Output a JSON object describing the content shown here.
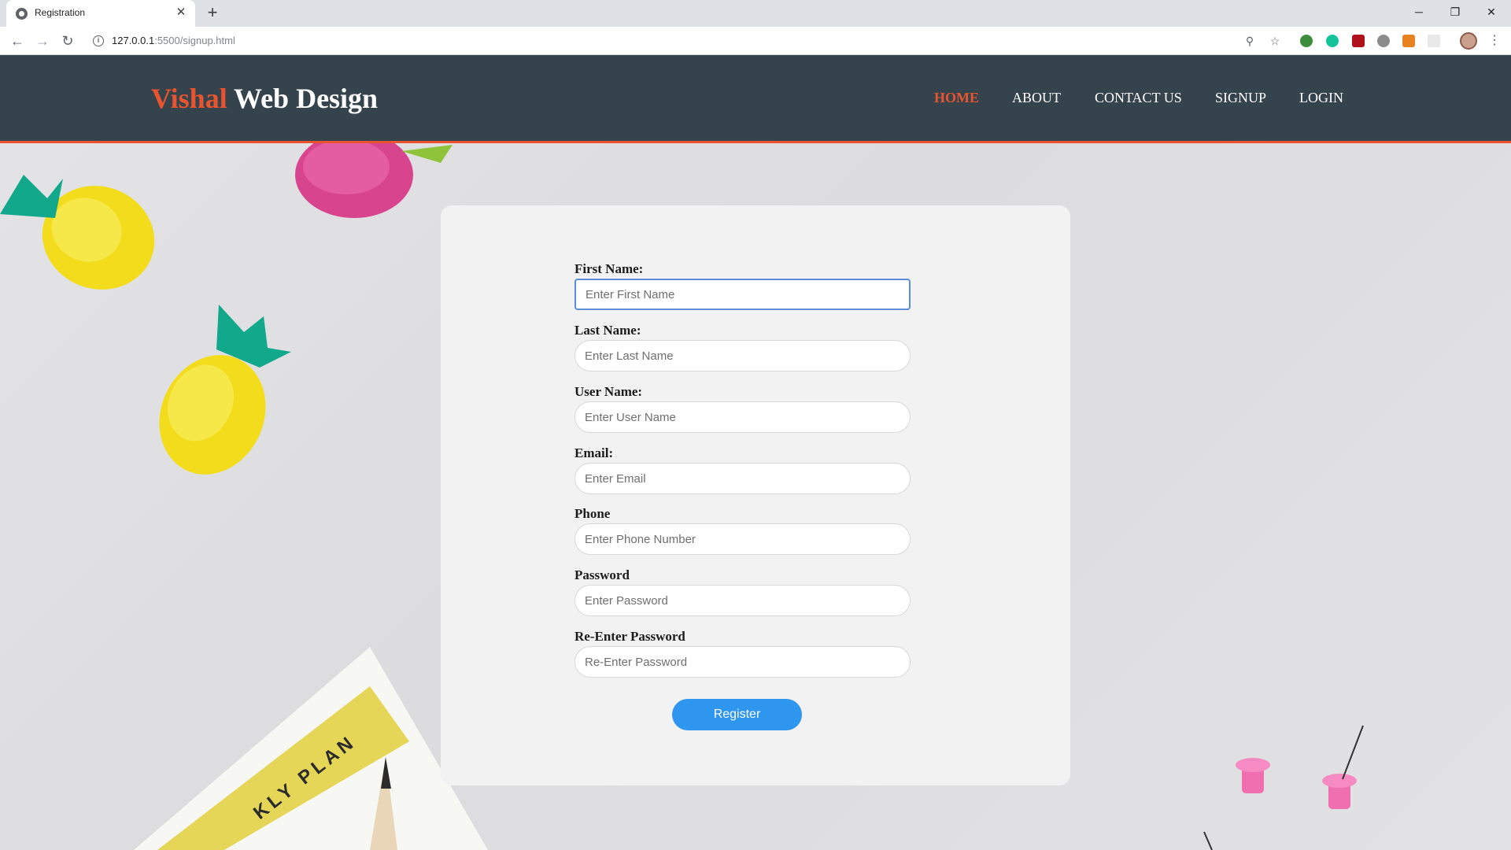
{
  "browser": {
    "tab_title": "Registration",
    "url_host": "127.0.0.1",
    "url_rest": ":5500/signup.html",
    "tab_close": "✕",
    "new_tab": "+",
    "window_controls": {
      "minimize": "─",
      "restore": "❐",
      "close": "✕"
    },
    "icons": [
      "back-icon",
      "forward-icon",
      "reload-icon",
      "info-icon",
      "zoom-icon",
      "star-icon",
      "extension-icons",
      "profile-avatar",
      "menu-icon"
    ]
  },
  "site": {
    "logo_accent": "Vishal",
    "logo_rest": " Web Design",
    "nav": [
      {
        "label": "HOME",
        "active": true
      },
      {
        "label": "ABOUT",
        "active": false
      },
      {
        "label": "CONTACT US",
        "active": false
      },
      {
        "label": "SIGNUP",
        "active": false
      },
      {
        "label": "LOGIN",
        "active": false
      }
    ],
    "colors": {
      "header_bg": "#35434d",
      "accent": "#e8542f",
      "button": "#2f96f0",
      "card_bg": "#f2f2f2"
    }
  },
  "form": {
    "fields": [
      {
        "label": "First Name:",
        "placeholder": "Enter First Name",
        "value": "",
        "focused": true
      },
      {
        "label": "Last Name:",
        "placeholder": "Enter Last Name",
        "value": ""
      },
      {
        "label": "User Name:",
        "placeholder": "Enter User Name",
        "value": ""
      },
      {
        "label": "Email:",
        "placeholder": "Enter Email",
        "value": ""
      },
      {
        "label": "Phone",
        "placeholder": "Enter Phone Number",
        "value": ""
      },
      {
        "label": "Password",
        "placeholder": "Enter Password",
        "value": ""
      },
      {
        "label": "Re-Enter Password",
        "placeholder": "Re-Enter Password",
        "value": ""
      }
    ],
    "submit_label": "Register"
  },
  "background": {
    "notebook_text": "KLY PLAN"
  }
}
